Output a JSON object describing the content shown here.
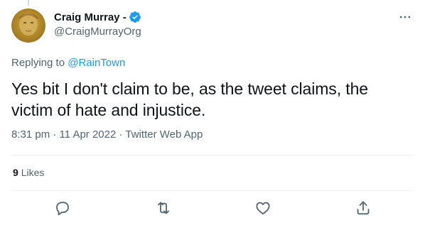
{
  "author": {
    "display_name": "Craig Murray -",
    "handle": "@CraigMurrayOrg",
    "verified": true
  },
  "reply_context": {
    "prefix": "Replying to",
    "mention": "@RainTown"
  },
  "tweet": {
    "text": "Yes bit I don't claim to be, as the tweet claims, the victim of hate and injustice.",
    "time": "8:31 pm",
    "separator": " · ",
    "date": "11 Apr 2022",
    "source": "Twitter Web App"
  },
  "stats": {
    "likes_count": "9",
    "likes_label": "Likes"
  },
  "icons": {
    "verified": "verified-badge-icon",
    "more": "more-icon",
    "reply": "reply-icon",
    "retweet": "retweet-icon",
    "like": "like-icon",
    "share": "share-icon"
  },
  "colors": {
    "accent": "#1d9bf0",
    "secondary_text": "#536471",
    "primary_text": "#0f1419"
  }
}
